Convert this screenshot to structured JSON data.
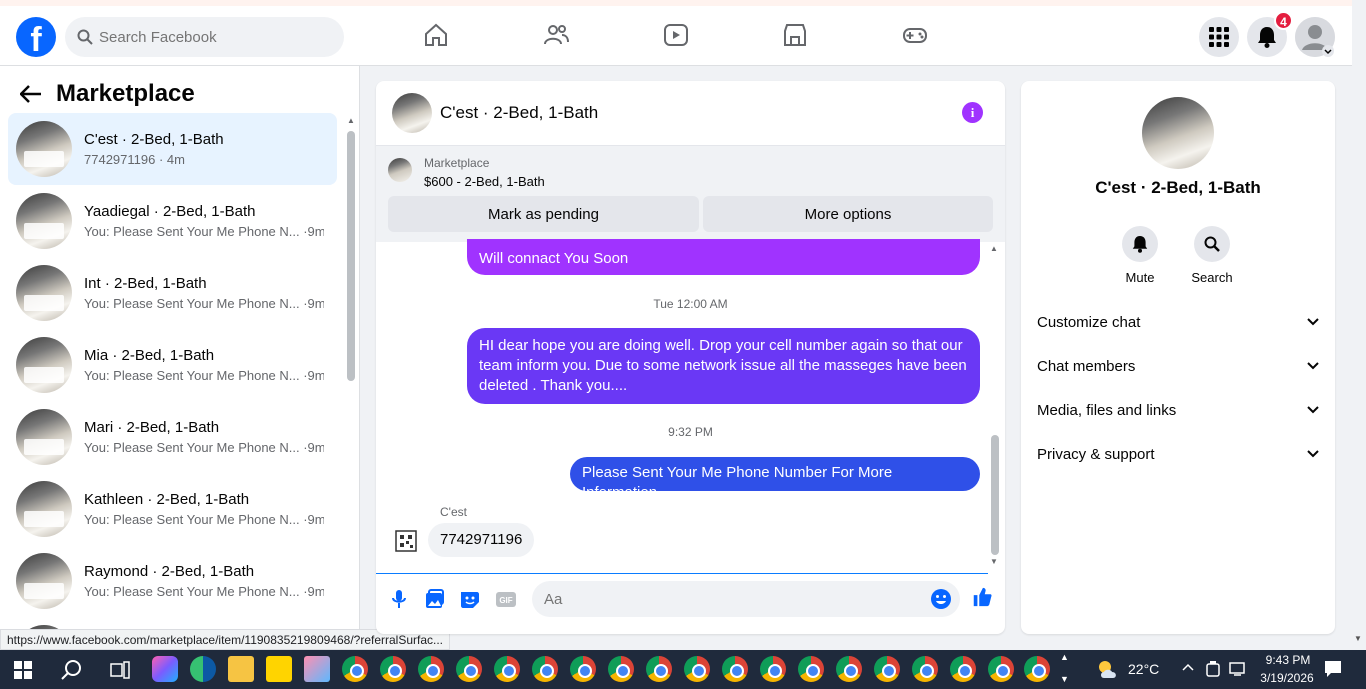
{
  "topbar": {
    "search_placeholder": "Search Facebook",
    "notification_count": "4"
  },
  "sidebar": {
    "title": "Marketplace",
    "conversations": [
      {
        "name": "C'est · 2-Bed, 1-Bath",
        "subtitle": "7742971196 · 4m"
      },
      {
        "name": "Yaadiegal · 2-Bed, 1-Bath",
        "subtitle": "You: Please Sent Your Me Phone N... ·9m"
      },
      {
        "name": "Int · 2-Bed, 1-Bath",
        "subtitle": "You: Please Sent Your Me Phone N... ·9m"
      },
      {
        "name": "Mia · 2-Bed, 1-Bath",
        "subtitle": "You: Please Sent Your Me Phone N... ·9m"
      },
      {
        "name": "Mari · 2-Bed, 1-Bath",
        "subtitle": "You: Please Sent Your Me Phone N... ·9m"
      },
      {
        "name": "Kathleen · 2-Bed, 1-Bath",
        "subtitle": "You: Please Sent Your Me Phone N... ·9m"
      },
      {
        "name": "Raymond · 2-Bed, 1-Bath",
        "subtitle": "You: Please Sent Your Me Phone N... ·9m"
      }
    ]
  },
  "status_url": "https://www.facebook.com/marketplace/item/1190835219809468/?referralSurfac...",
  "chat": {
    "title": "C'est · 2-Bed, 1-Bath",
    "marketplace_label": "Marketplace",
    "listing": "$600 - 2-Bed, 1-Bath",
    "mark_pending": "Mark as pending",
    "more_options": "More options",
    "messages": {
      "partial": "Will connact You Soon",
      "ts1": "Tue 12:00 AM",
      "msg2": "HI dear hope you are doing well.  Drop your cell number again so that our team  inform you.  Due to some network issue all the masseges have been deleted . Thank you....",
      "ts2": "9:32 PM",
      "msg3": "Please Sent Your Me Phone Number For More Information",
      "sender": "C'est",
      "reply": "7742971196"
    },
    "composer_placeholder": "Aa"
  },
  "details": {
    "name": "C'est · 2-Bed, 1-Bath",
    "mute": "Mute",
    "search": "Search",
    "sections": [
      "Customize chat",
      "Chat members",
      "Media, files and links",
      "Privacy & support"
    ]
  },
  "taskbar": {
    "temperature": "22°C",
    "time": "9:43 PM",
    "date": "3/19/2026"
  },
  "colors": {
    "fb_blue": "#0866ff",
    "bubble_purple": "#a033ff",
    "bubble_violet": "#6a38f5",
    "bubble_blue": "#2f50e8"
  }
}
